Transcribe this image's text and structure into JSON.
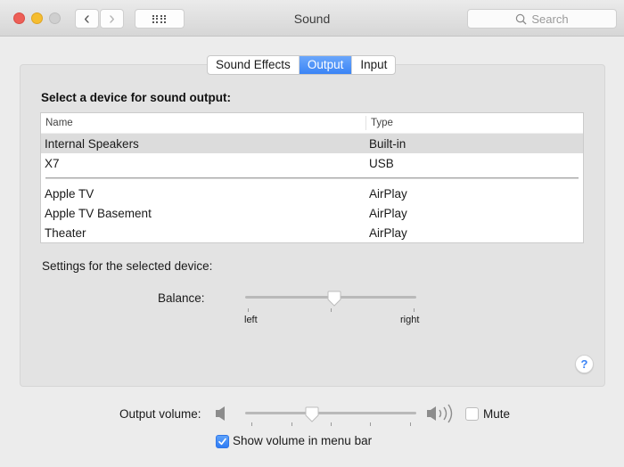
{
  "window": {
    "title": "Sound",
    "search_placeholder": "Search",
    "back_glyph": "‹",
    "forward_glyph": "›"
  },
  "tabs": [
    {
      "label": "Sound Effects",
      "active": false
    },
    {
      "label": "Output",
      "active": true
    },
    {
      "label": "Input",
      "active": false
    }
  ],
  "output": {
    "heading": "Select a device for sound output:",
    "columns": {
      "name": "Name",
      "type": "Type"
    },
    "devices_group1": [
      {
        "name": "Internal Speakers",
        "type": "Built-in",
        "selected": true
      },
      {
        "name": "X7",
        "type": "USB",
        "selected": false
      }
    ],
    "devices_group2": [
      {
        "name": "Apple TV",
        "type": "AirPlay",
        "selected": false
      },
      {
        "name": "Apple TV Basement",
        "type": "AirPlay",
        "selected": false
      },
      {
        "name": "Theater",
        "type": "AirPlay",
        "selected": false
      }
    ],
    "settings_label": "Settings for the selected device:",
    "balance": {
      "label": "Balance:",
      "left_label": "left",
      "right_label": "right",
      "value": 0.5
    },
    "help_glyph": "?"
  },
  "volume": {
    "label": "Output volume:",
    "value": 0.39,
    "mute_label": "Mute",
    "muted": false,
    "show_in_menu_bar_label": "Show volume in menu bar",
    "show_in_menu_bar": true
  },
  "colors": {
    "accent": "#3b84f5",
    "close": "#ed5f57",
    "minimize": "#f5bd30",
    "zoom_disabled": "#cfcfcf"
  }
}
